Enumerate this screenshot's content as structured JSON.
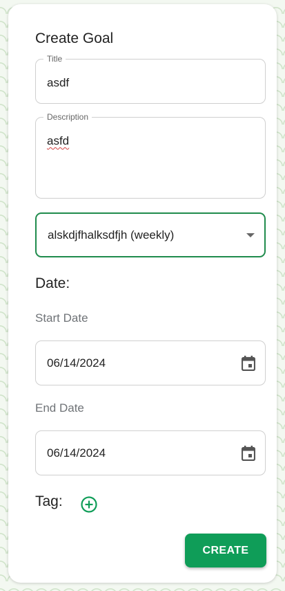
{
  "form": {
    "heading": "Create Goal",
    "title_field": {
      "label": "Title",
      "value": "asdf"
    },
    "description_field": {
      "label": "Description",
      "value": "asfd"
    },
    "goal_select": {
      "selected": "alskdjfhalksdfjh (weekly)"
    },
    "date_section_label": "Date:",
    "start_date": {
      "label": "Start Date",
      "value": "06/14/2024"
    },
    "end_date": {
      "label": "End Date",
      "value": "06/14/2024"
    },
    "tag_label": "Tag:",
    "create_button": "CREATE"
  },
  "colors": {
    "accent": "#0f9d58",
    "select_border": "#1f8b4c",
    "background_pattern": "#cfe3c9"
  },
  "icons": {
    "date_picker": "calendar-icon",
    "add_tag": "plus-circle-icon",
    "select_caret": "caret-down-icon"
  }
}
